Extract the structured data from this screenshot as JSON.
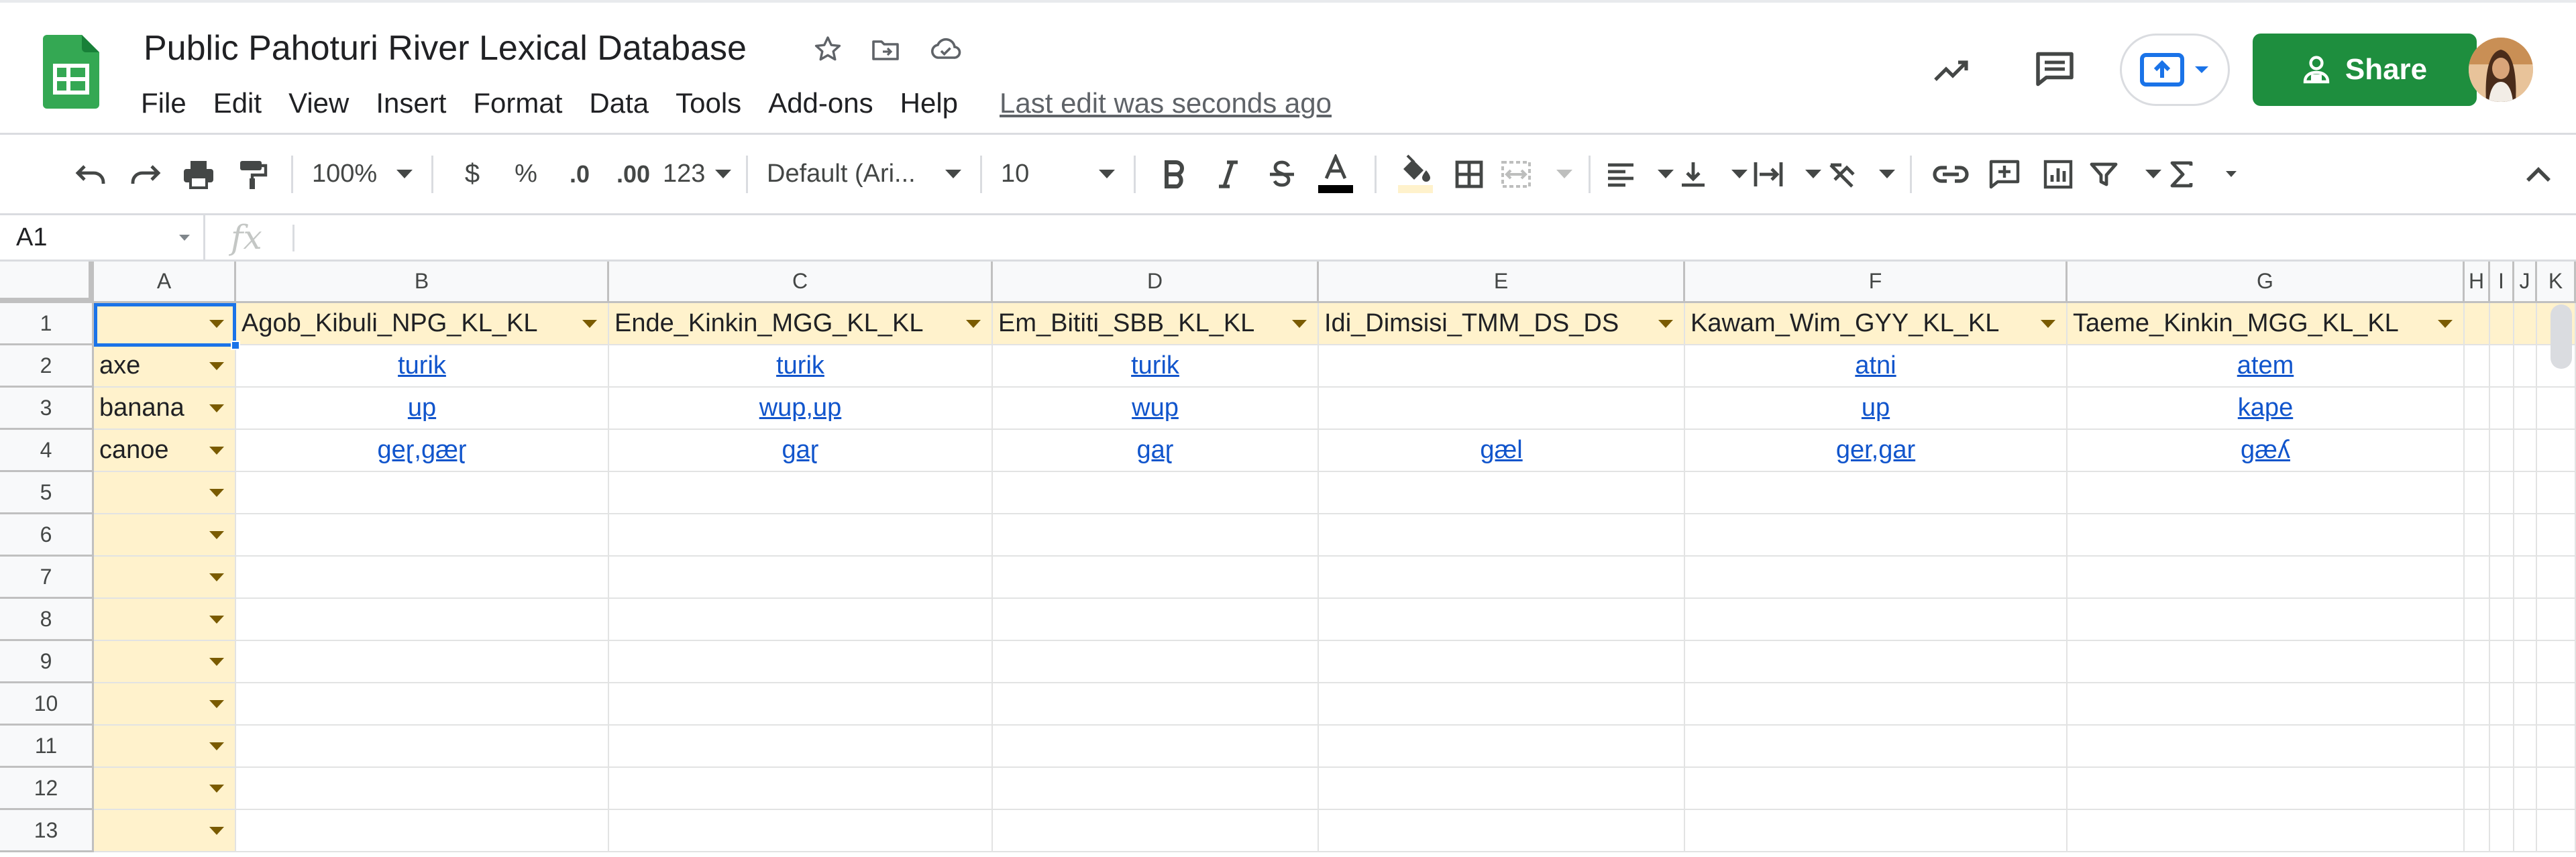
{
  "app": {
    "title": "Public Pahoturi River Lexical Database",
    "menus": [
      "File",
      "Edit",
      "View",
      "Insert",
      "Format",
      "Data",
      "Tools",
      "Add-ons",
      "Help"
    ],
    "last_edit": "Last edit was seconds ago",
    "share_label": "Share",
    "brand_color": "#1e8e3e"
  },
  "toolbar": {
    "zoom": "100%",
    "currency": "$",
    "percent": "%",
    "dec_decrease": ".0",
    "dec_increase": ".00",
    "more_formats": "123",
    "font": "Default (Ari...",
    "font_size": "10"
  },
  "formula_bar": {
    "cell_ref": "A1",
    "fx": "fx",
    "value": ""
  },
  "sheet": {
    "columns": [
      "A",
      "B",
      "C",
      "D",
      "E",
      "F",
      "G",
      "H",
      "I",
      "J",
      "K"
    ],
    "rows": [
      "1",
      "2",
      "3",
      "4",
      "5",
      "6",
      "7",
      "8",
      "9",
      "10",
      "11",
      "12",
      "13"
    ],
    "headers": [
      "",
      "Agob_Kibuli_NPG_KL_KL",
      "Ende_Kinkin_MGG_KL_KL",
      "Em_Bititi_SBB_KL_KL",
      "Idi_Dimsisi_TMM_DS_DS",
      "Kawam_Wim_GYY_KL_KL",
      "Taeme_Kinkin_MGG_KL_KL"
    ],
    "data": [
      [
        "axe",
        "turik",
        "turik",
        "turik",
        "",
        "atni",
        "atem"
      ],
      [
        "banana",
        "up",
        "wup,up",
        "wup",
        "",
        "up",
        "kape"
      ],
      [
        "canoe",
        "geɽ,gæɽ",
        "gaɽ",
        "gaɽ",
        "gæl",
        "ger,gar",
        "gæʎ"
      ]
    ],
    "header_fill": "#fff2cc",
    "link_color": "#1155cc",
    "selection_color": "#1a73e8"
  }
}
